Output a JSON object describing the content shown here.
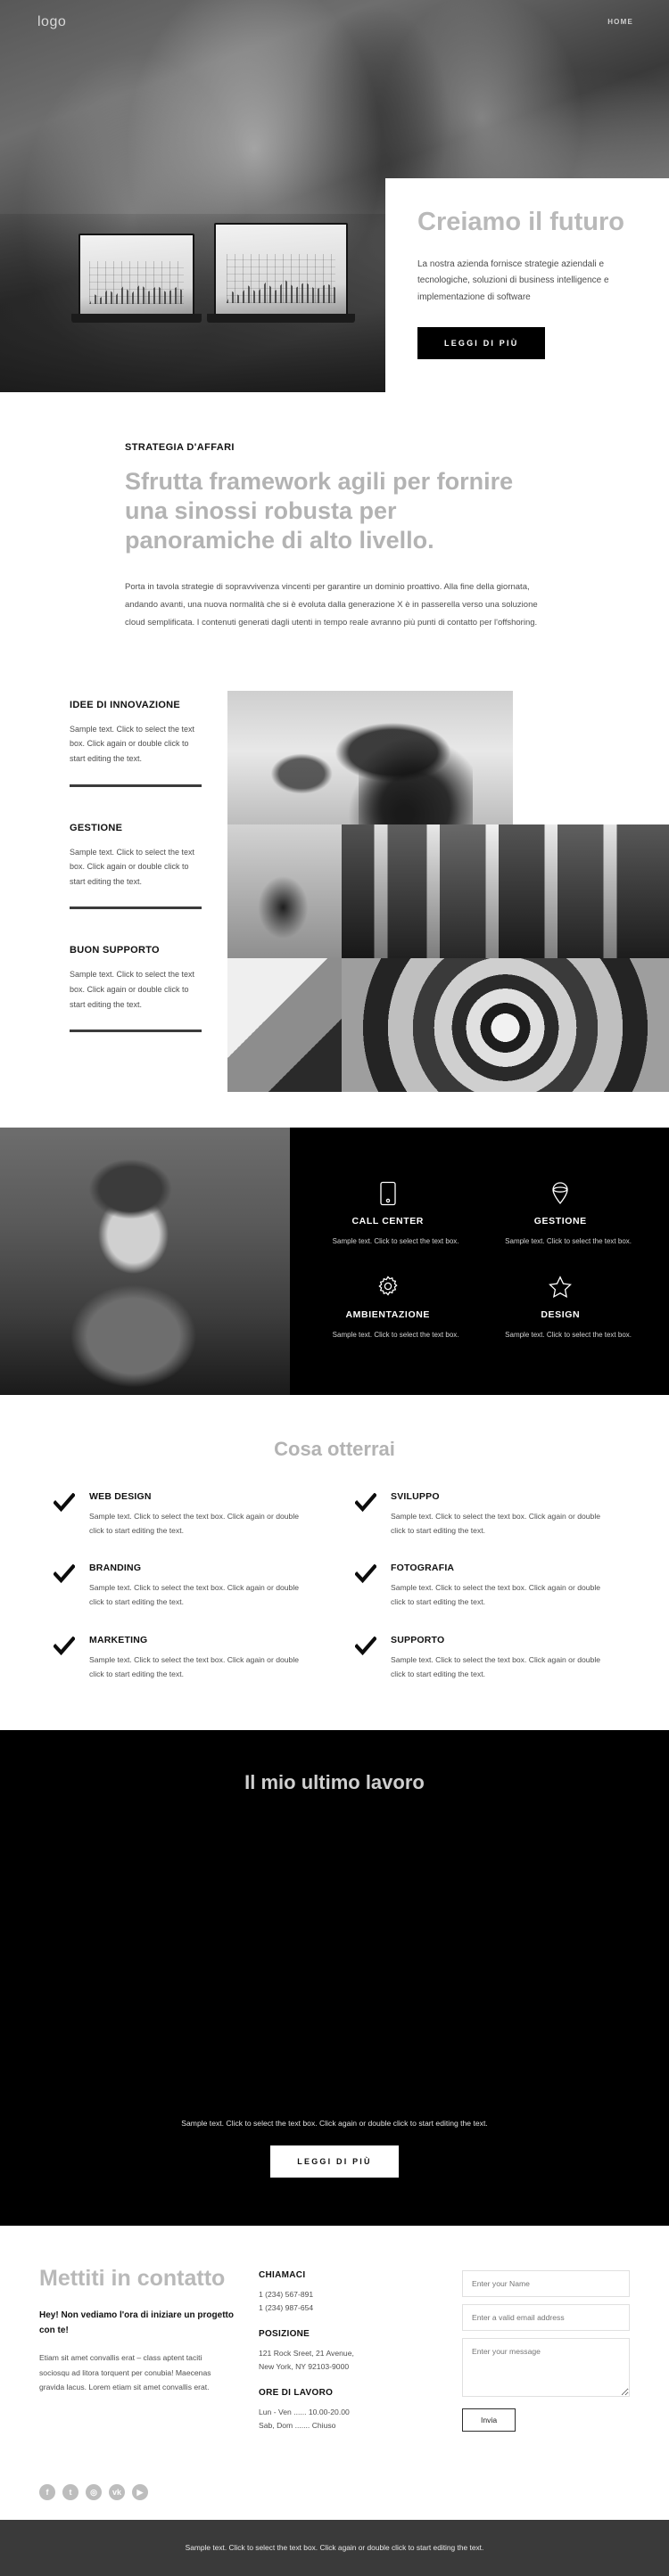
{
  "header": {
    "logo": "logo",
    "nav": [
      {
        "label": "HOME"
      }
    ]
  },
  "hero": {
    "title": "Creiamo il futuro",
    "paragraph": "La nostra azienda fornisce strategie aziendali e tecnologiche, soluzioni di business intelligence e implementazione di software",
    "cta": "LEGGI DI PIÙ"
  },
  "strategy": {
    "eyebrow": "STRATEGIA D'AFFARI",
    "heading": "Sfrutta framework agili per fornire una sinossi robusta per panoramiche di alto livello.",
    "paragraph": "Porta in tavola strategie di sopravvivenza vincenti per garantire un dominio proattivo. Alla fine della giornata, andando avanti, una nuova normalità che si è evoluta dalla generazione X è in passerella verso una soluzione cloud semplificata. I contenuti generati dagli utenti in tempo reale avranno più punti di contatto per l'offshoring."
  },
  "features": [
    {
      "title": "IDEE DI INNOVAZIONE",
      "text": "Sample text. Click to select the text box. Click again or double click to start editing the text."
    },
    {
      "title": "GESTIONE",
      "text": "Sample text. Click to select the text box. Click again or double click to start editing the text."
    },
    {
      "title": "BUON SUPPORTO",
      "text": "Sample text. Click to select the text box. Click again or double click to start editing the text."
    }
  ],
  "services": [
    {
      "icon": "phone-icon",
      "title": "CALL CENTER",
      "text": "Sample text. Click to select the text box."
    },
    {
      "icon": "location-pin-icon",
      "title": "GESTIONE",
      "text": "Sample text. Click to select the text box."
    },
    {
      "icon": "gear-icon",
      "title": "AMBIENTAZIONE",
      "text": "Sample text. Click to select the text box."
    },
    {
      "icon": "star-icon",
      "title": "DESIGN",
      "text": "Sample text. Click to select the text box."
    }
  ],
  "benefits": {
    "heading": "Cosa otterrai",
    "items": [
      {
        "title": "WEB DESIGN",
        "text": "Sample text. Click to select the text box. Click again or double click to start editing the text."
      },
      {
        "title": "SVILUPPO",
        "text": "Sample text. Click to select the text box. Click again or double click to start editing the text."
      },
      {
        "title": "BRANDING",
        "text": "Sample text. Click to select the text box. Click again or double click to start editing the text."
      },
      {
        "title": "FOTOGRAFIA",
        "text": "Sample text. Click to select the text box. Click again or double click to start editing the text."
      },
      {
        "title": "MARKETING",
        "text": "Sample text. Click to select the text box. Click again or double click to start editing the text."
      },
      {
        "title": "SUPPORTO",
        "text": "Sample text. Click to select the text box. Click again or double click to start editing the text."
      }
    ]
  },
  "portfolio": {
    "heading": "Il mio ultimo lavoro",
    "note": "Sample text. Click to select the text box. Click again or double click to start editing the text.",
    "cta": "LEGGI DI PIÙ"
  },
  "contact": {
    "heading": "Mettiti in contatto",
    "lead": "Hey! Non vediamo l'ora di iniziare un progetto con te!",
    "body": "Etiam sit amet convallis erat – class aptent taciti sociosqu ad litora torquent per conubia! Maecenas gravida lacus. Lorem etiam sit amet convallis erat.",
    "call_title": "CHIAMACI",
    "phone1": "1 (234) 567-891",
    "phone2": "1 (234) 987-654",
    "location_title": "POSIZIONE",
    "address1": "121 Rock Sreet, 21 Avenue,",
    "address2": "New York, NY 92103-9000",
    "hours_title": "ORE DI LAVORO",
    "hours1": "Lun - Ven ...... 10.00-20.00",
    "hours2": "Sab, Dom ....... Chiuso",
    "form": {
      "name_placeholder": "Enter your Name",
      "email_placeholder": "Enter a valid email address",
      "message_placeholder": "Enter your message",
      "submit": "Invia"
    },
    "socials": [
      {
        "name": "facebook-icon",
        "glyph": "f"
      },
      {
        "name": "twitter-icon",
        "glyph": "t"
      },
      {
        "name": "instagram-icon",
        "glyph": "◎"
      },
      {
        "name": "vk-icon",
        "glyph": "vk"
      },
      {
        "name": "youtube-icon",
        "glyph": "▶"
      }
    ]
  },
  "footer": {
    "text": "Sample text. Click to select the text box. Click again or double click to start editing the text."
  },
  "colors": {
    "dark": "#000000",
    "muted_heading": "#b3b3b3",
    "footer_bg": "#3a3a3a"
  }
}
